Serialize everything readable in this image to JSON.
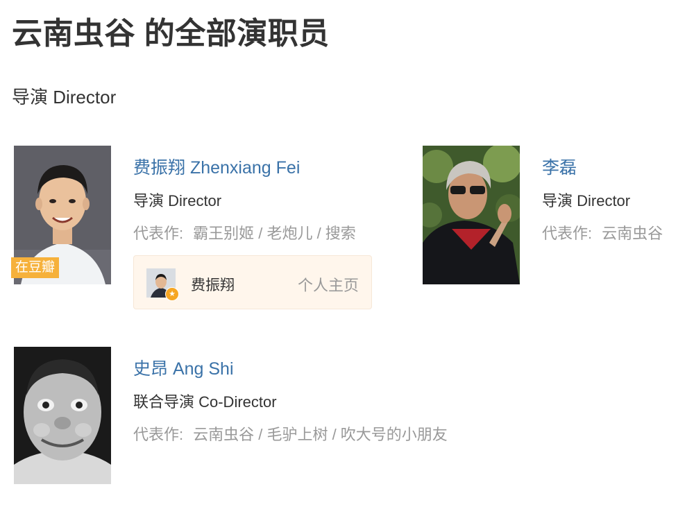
{
  "page_title": "云南虫谷 的全部演职员",
  "section": {
    "heading": "导演 Director"
  },
  "celebrities": [
    {
      "name": "费振翔 Zhenxiang Fei",
      "role": "导演 Director",
      "works_label": "代表作:",
      "works": "霸王别姬 / 老炮儿 / 搜索",
      "badge": "在豆瓣",
      "profile_card": {
        "name": "费振翔",
        "link_label": "个人主页",
        "verified_icon": "star-badge-icon"
      }
    },
    {
      "name": "李磊",
      "role": "导演 Director",
      "works_label": "代表作:",
      "works": "云南虫谷"
    },
    {
      "name": "史昂 Ang Shi",
      "role": "联合导演 Co-Director",
      "works_label": "代表作:",
      "works": "云南虫谷 / 毛驴上树 / 吹大号的小朋友"
    }
  ],
  "colors": {
    "link": "#3a72a8",
    "muted": "#999999",
    "badge": "#f6b13b",
    "card_bg": "#fff6ec"
  }
}
